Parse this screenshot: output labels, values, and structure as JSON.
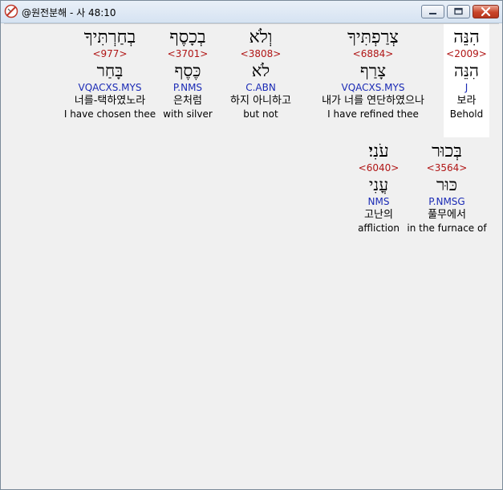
{
  "window": {
    "title": "@원전분해 - 사 48:10"
  },
  "row1": [
    {
      "heb": "בְחַרְתִּיךָ",
      "strong": "<977>",
      "root": "בָּחַר",
      "morph": "VQACXS.MYS",
      "kor": "너를-택하였노라",
      "eng": "I have chosen thee"
    },
    {
      "heb": "בְכָסֶף",
      "strong": "<3701>",
      "root": "כֶּסֶף",
      "morph": "P.NMS",
      "kor": "은처럼",
      "eng": "with silver"
    },
    {
      "heb": "וְלֹא",
      "strong": "<3808>",
      "root": "לֹא",
      "morph": "C.ABN",
      "kor": "하지 아니하고",
      "eng": "but not"
    },
    {
      "heb": "צְרַפְתִּיךָ",
      "strong": "<6884>",
      "root": "צָרַף",
      "morph": "VQACXS.MYS",
      "kor": "내가 너를 연단하였으나",
      "eng": "I have refined thee"
    },
    {
      "heb": "הִנֵּה",
      "strong": "<2009>",
      "root": "הִנֵּה",
      "morph": "J",
      "kor": "보라",
      "eng": "Behold"
    }
  ],
  "row2": [
    {
      "heb": "עֹנִי׃",
      "strong": "<6040>",
      "root": "עֳנִי",
      "morph": "NMS",
      "kor": "고난의",
      "eng": "affliction"
    },
    {
      "heb": "בְּכוּר",
      "strong": "<3564>",
      "root": "כּוּר",
      "morph": "P.NMSG",
      "kor": "풀무에서",
      "eng": "in the furnace of"
    }
  ]
}
